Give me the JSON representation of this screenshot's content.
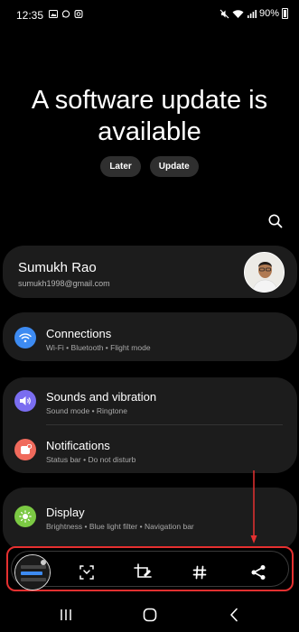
{
  "status_bar": {
    "time": "12:35",
    "battery": "90%",
    "left_icons": [
      "gallery-icon",
      "whatsapp-icon",
      "instagram-icon"
    ],
    "right_icons": [
      "mute-icon",
      "wifi-icon",
      "signal-icon",
      "battery-icon"
    ]
  },
  "banner": {
    "title_line1": "A software update is",
    "title_line2": "available",
    "later_label": "Later",
    "update_label": "Update"
  },
  "account": {
    "name": "Sumukh Rao",
    "email": "sumukh1998@gmail.com"
  },
  "settings": [
    {
      "title": "Connections",
      "subtitle": "Wi-Fi  •  Bluetooth  •  Flight mode",
      "icon": "wifi-icon",
      "color": "#3d8bf2"
    },
    {
      "title": "Sounds and vibration",
      "subtitle": "Sound mode  •  Ringtone",
      "icon": "volume-icon",
      "color": "#7a6df0"
    },
    {
      "title": "Notifications",
      "subtitle": "Status bar  •  Do not disturb",
      "icon": "notification-icon",
      "color": "#f06a5c"
    },
    {
      "title": "Display",
      "subtitle": "Brightness  •  Blue light filter  •  Navigation bar",
      "icon": "sun-icon",
      "color": "#7bc943"
    }
  ],
  "toolbar": {
    "icons": [
      "scroll-capture-icon",
      "crop-edit-icon",
      "hashtag-icon",
      "share-icon"
    ],
    "highlight_color": "#e53030"
  },
  "navbar": {
    "icons": [
      "recents-icon",
      "home-icon",
      "back-icon"
    ]
  }
}
